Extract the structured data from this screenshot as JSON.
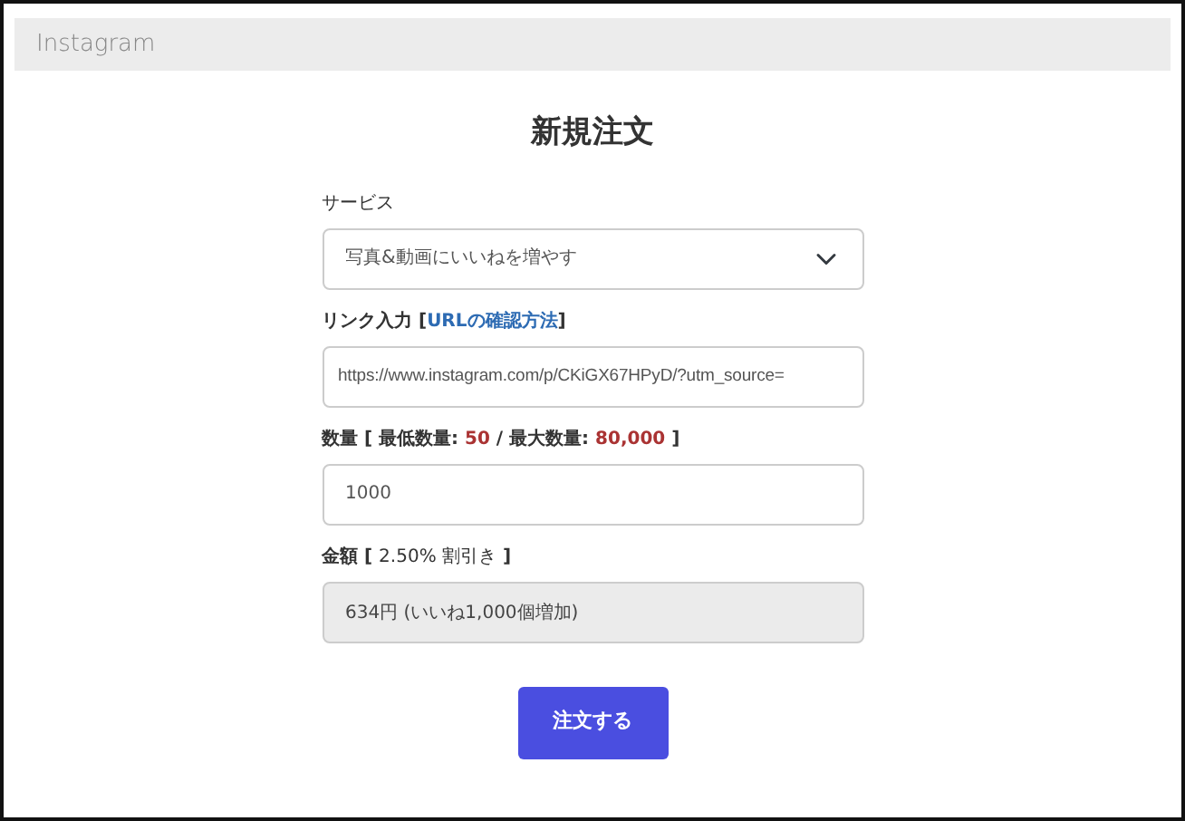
{
  "header": {
    "title": "Instagram"
  },
  "form": {
    "title": "新規注文",
    "service": {
      "label": "サービス",
      "value": "写真&動画にいいねを増やす"
    },
    "link": {
      "label_before": "リンク入力 [",
      "link_text": "URLの確認方法",
      "label_after": "]",
      "value": "https://www.instagram.com/p/CKiGX67HPyD/?utm_source="
    },
    "quantity": {
      "label_before": "数量 [ 最低数量: ",
      "min": "50",
      "label_middle": " / 最大数量: ",
      "max": "80,000",
      "label_after": " ]",
      "value": "1000"
    },
    "amount": {
      "label_before": "金額 [ ",
      "discount": "2.50% 割引き",
      "label_after": " ]",
      "value": "634円 (いいね1,000個増加)",
      "disabled": true
    },
    "submit": {
      "label": "注文する"
    }
  }
}
